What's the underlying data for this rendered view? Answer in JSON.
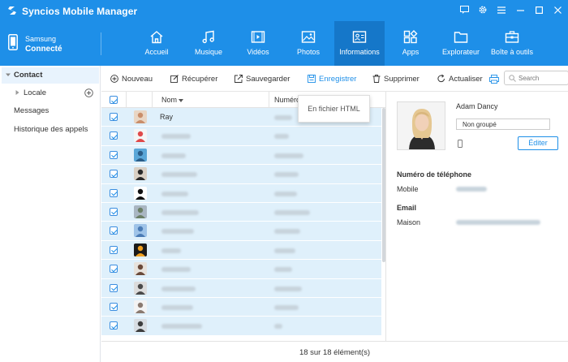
{
  "app": {
    "title": "Syncios Mobile Manager"
  },
  "window_controls": [
    "feedback-icon",
    "gear-icon",
    "menu-icon",
    "minimize-icon",
    "maximize-icon",
    "close-icon"
  ],
  "device": {
    "name": "Samsung",
    "status": "Connecté"
  },
  "nav": {
    "items": [
      {
        "label": "Accueil",
        "icon": "home-icon"
      },
      {
        "label": "Musique",
        "icon": "music-icon"
      },
      {
        "label": "Vidéos",
        "icon": "video-icon"
      },
      {
        "label": "Photos",
        "icon": "photo-icon"
      },
      {
        "label": "Informations",
        "icon": "contact-card-icon",
        "active": true
      },
      {
        "label": "Apps",
        "icon": "apps-icon"
      },
      {
        "label": "Explorateur",
        "icon": "folder-icon"
      },
      {
        "label": "Boîte à outils",
        "icon": "toolbox-icon"
      }
    ]
  },
  "sidebar": {
    "contact": "Contact",
    "locale": "Locale",
    "messages": "Messages",
    "call_history": "Historique des appels"
  },
  "toolbar": {
    "new": "Nouveau",
    "recover": "Récupérer",
    "backup": "Sauvegarder",
    "save": "Enregistrer",
    "delete": "Supprimer",
    "refresh": "Actualiser",
    "search_placeholder": "Search"
  },
  "tooltip": {
    "text": "En fichier HTML"
  },
  "table": {
    "columns": {
      "name": "Nom",
      "number": "Numéro"
    },
    "first_row_name": "Ray",
    "row_count": 12,
    "footer": "18 sur 18 élément(s)"
  },
  "detail": {
    "name": "Adam Dancy",
    "group": "Non groupé",
    "edit": "Éditer",
    "phone_section": "Numéro de téléphone",
    "phone_type": "Mobile",
    "email_section": "Email",
    "email_type": "Maison"
  },
  "colors": {
    "accent": "#1e8fe8",
    "active_nav": "#1577c9",
    "row_selected": "#dff0fb"
  }
}
